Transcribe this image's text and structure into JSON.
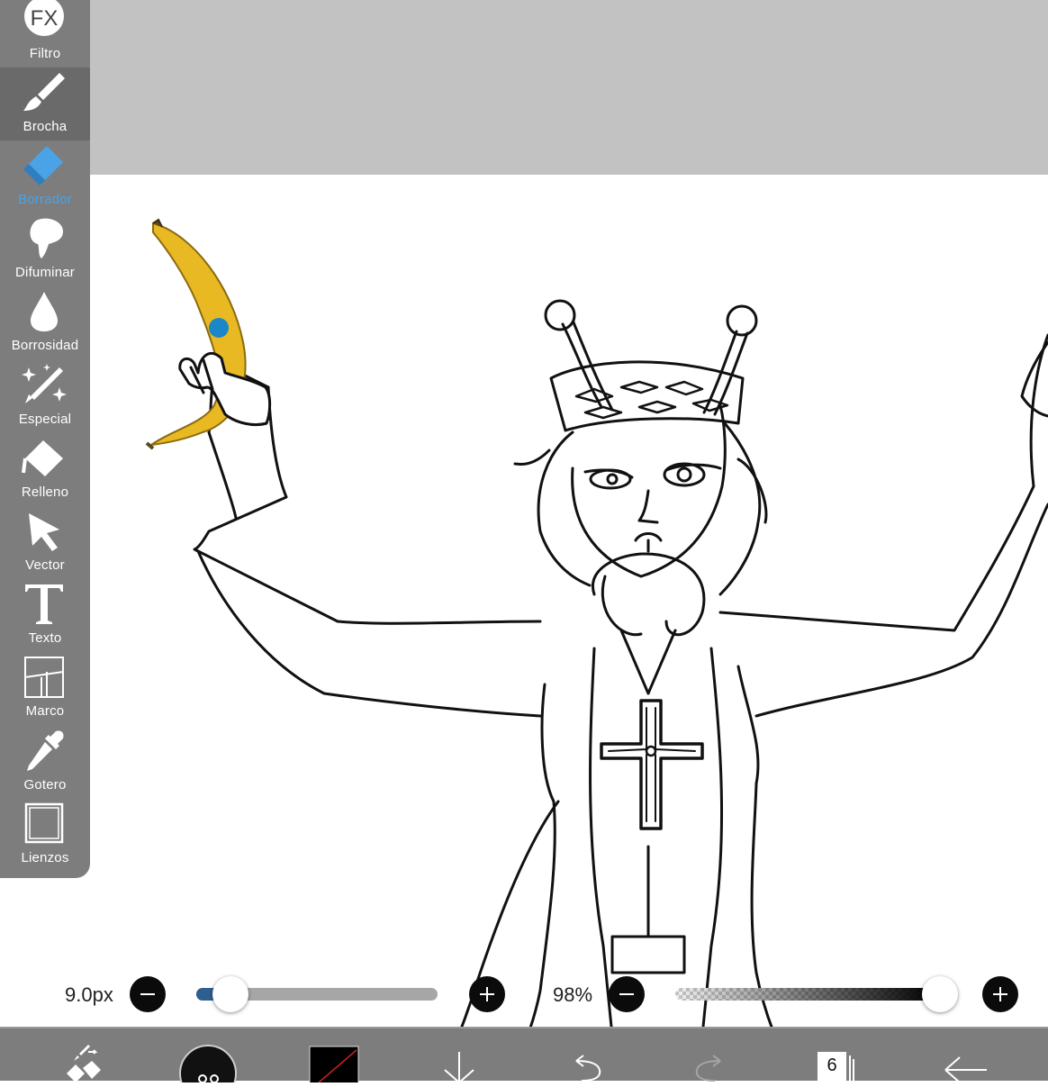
{
  "toolbar": {
    "tools": [
      {
        "label": "Filtro",
        "icon": "fx-icon"
      },
      {
        "label": "Brocha",
        "icon": "brush-icon"
      },
      {
        "label": "Borrador",
        "icon": "eraser-icon"
      },
      {
        "label": "Difuminar",
        "icon": "smudge-icon"
      },
      {
        "label": "Borrosidad",
        "icon": "blur-drop-icon"
      },
      {
        "label": "Especial",
        "icon": "magic-wand-icon"
      },
      {
        "label": "Relleno",
        "icon": "fill-bucket-icon"
      },
      {
        "label": "Vector",
        "icon": "cursor-arrow-icon"
      },
      {
        "label": "Texto",
        "icon": "text-t-icon"
      },
      {
        "label": "Marco",
        "icon": "frame-panels-icon"
      },
      {
        "label": "Gotero",
        "icon": "eyedropper-icon"
      },
      {
        "label": "Lienzos",
        "icon": "canvas-square-icon"
      }
    ],
    "fx_text": "FX",
    "selected": "Borrador"
  },
  "brush_size": {
    "value_text": "9.0px",
    "level": 0.14
  },
  "opacity": {
    "value_text": "98%",
    "level": 0.98
  },
  "bottom_bar": {
    "layers_count": "6",
    "color_swatch": "#000000"
  },
  "colors": {
    "toolbar_bg": "#7d7d7d",
    "active_tool_bg": "#6a6a6a",
    "selected_label": "#4aa3e6",
    "slider_fill": "#2f5f8f",
    "slider_track": "#a6a6a6",
    "top_gray": "#c2c2c2",
    "banana": "#e8b923"
  }
}
